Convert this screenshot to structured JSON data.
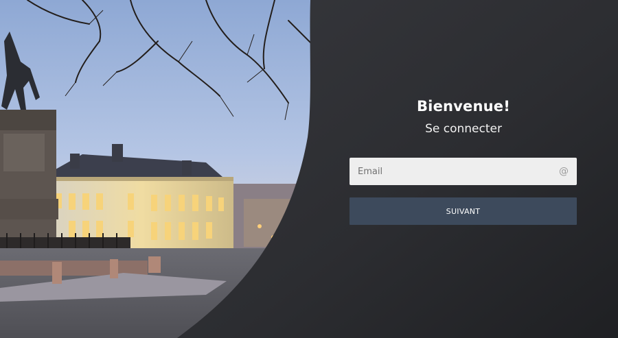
{
  "login": {
    "welcome": "Bienvenue!",
    "subtitle": "Se connecter",
    "email_placeholder": "Email",
    "email_value": "",
    "email_icon": "at-icon",
    "next_label": "SUIVANT"
  },
  "colors": {
    "panel": "#2a2b2f",
    "input_background": "#eeeeee",
    "button": "#3d4a5c",
    "text": "#ffffff"
  }
}
